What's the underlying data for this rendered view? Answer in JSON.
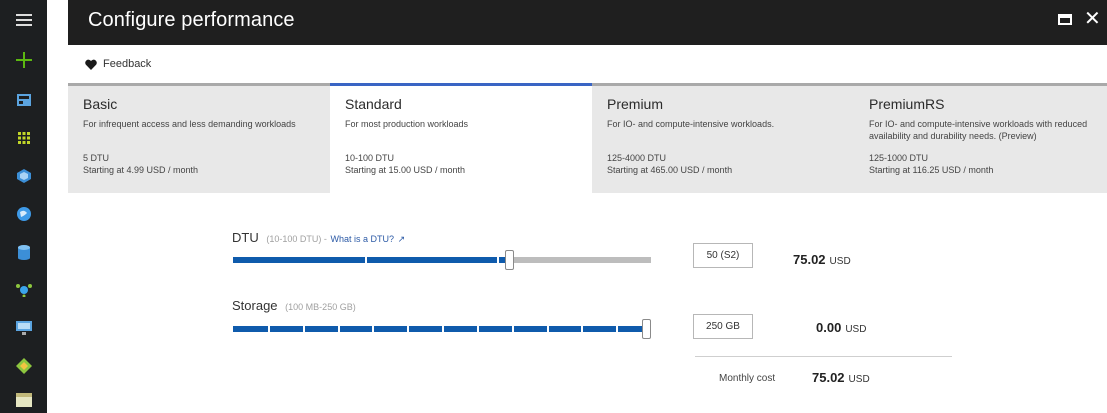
{
  "window": {
    "title": "Configure performance"
  },
  "rail": {
    "icons": [
      "hamburger-menu-icon",
      "plus-icon",
      "dashboard-icon",
      "all-resources-icon",
      "resource-group-icon",
      "globe-icon",
      "sql-database-icon",
      "network-icon",
      "monitor-icon",
      "extensions-icon",
      "storage-icon"
    ],
    "colors": {
      "plus": "#5cb811",
      "accent": "#8dc63f"
    }
  },
  "command_bar": {
    "feedback_label": "Feedback"
  },
  "tiers": [
    {
      "name": "Basic",
      "description": "For infrequent access and less demanding workloads",
      "dtu": "5 DTU",
      "price": "Starting at 4.99 USD / month",
      "selected": false
    },
    {
      "name": "Standard",
      "description": "For most production workloads",
      "dtu": "10-100 DTU",
      "price": "Starting at 15.00 USD / month",
      "selected": true
    },
    {
      "name": "Premium",
      "description": "For IO- and compute-intensive workloads.",
      "dtu": "125-4000 DTU",
      "price": "Starting at 465.00 USD / month",
      "selected": false
    },
    {
      "name": "PremiumRS",
      "description": "For IO- and compute-intensive workloads with reduced availability and durability needs. (Preview)",
      "dtu": "125-1000 DTU",
      "price": "Starting at 116.25 USD / month",
      "selected": false
    }
  ],
  "dtu": {
    "label": "DTU",
    "range": "(10-100 DTU) -",
    "help_link": "What is a DTU?",
    "value": "50 (S2)",
    "slider_fraction": 0.66,
    "cost": "75.02",
    "currency": "USD"
  },
  "storage": {
    "label": "Storage",
    "range": "(100 MB-250 GB)",
    "value": "250 GB",
    "slider_fraction": 1.0,
    "cost": "0.00",
    "currency": "USD"
  },
  "monthly": {
    "label": "Monthly cost",
    "cost": "75.02",
    "currency": "USD"
  }
}
